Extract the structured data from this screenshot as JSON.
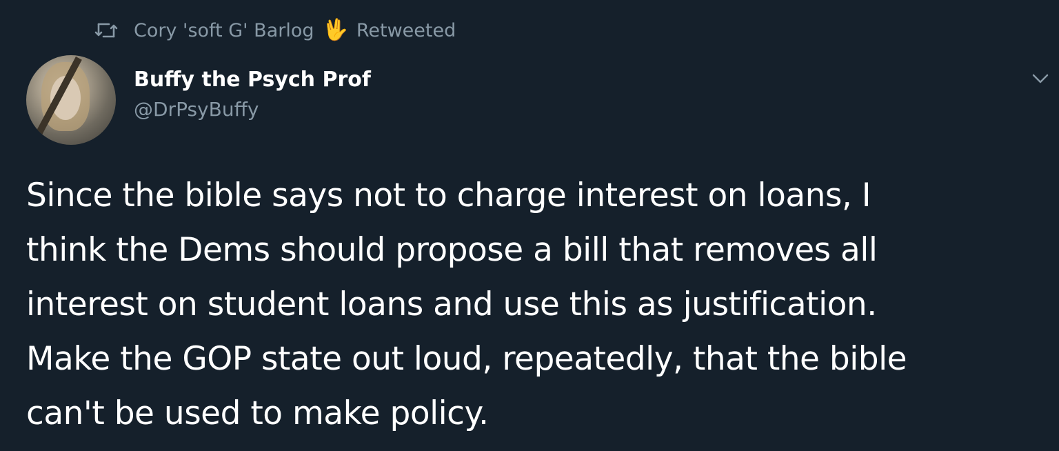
{
  "retweet": {
    "icon": "retweet-icon",
    "retweeter_name": "Cory 'soft G' Barlog",
    "emoji": "🖖",
    "label": "Retweeted"
  },
  "author": {
    "display_name": "Buffy the Psych Prof",
    "handle": "@DrPsyBuffy",
    "avatar": "avatar-image"
  },
  "menu": {
    "icon": "chevron-down-icon"
  },
  "tweet": {
    "lines": [
      "Since the bible says not to charge interest on loans, I",
      "think the Dems should propose a bill that removes all",
      "interest on student loans and use this as justification.",
      "Make the GOP state out loud, repeatedly, that the bible",
      "can't be used to make policy."
    ]
  },
  "colors": {
    "background": "#15202b",
    "text": "#ffffff",
    "secondary_text": "#8899a6"
  }
}
